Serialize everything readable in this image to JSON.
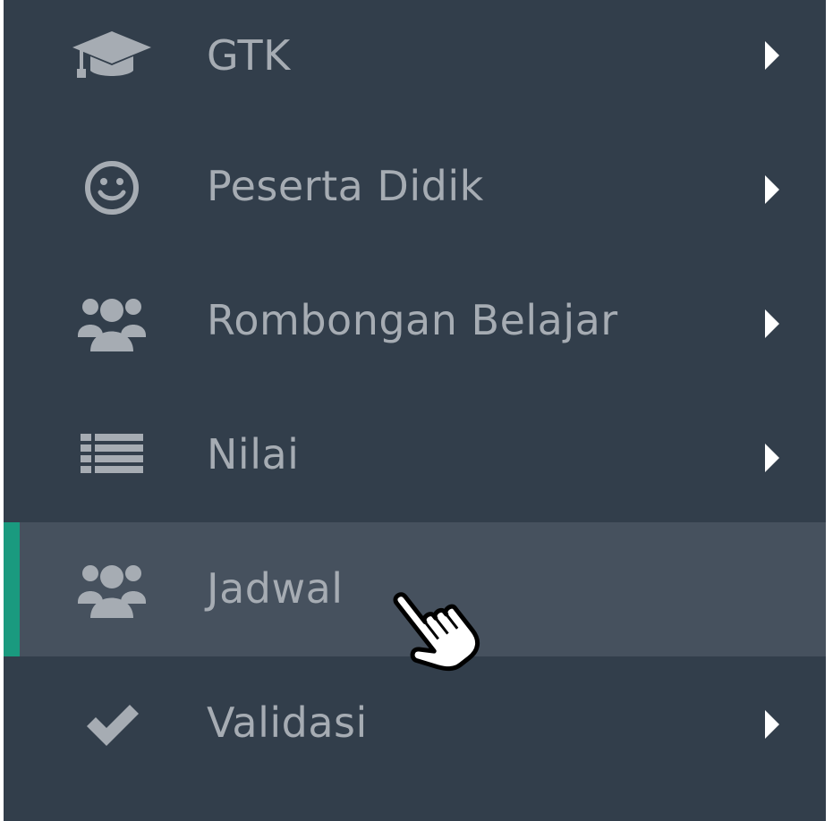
{
  "sidebar": {
    "items": [
      {
        "label": "GTK",
        "icon": "graduation-cap-icon",
        "has_submenu": true,
        "active": false
      },
      {
        "label": "Peserta Didik",
        "icon": "smile-icon",
        "has_submenu": true,
        "active": false
      },
      {
        "label": "Rombongan Belajar",
        "icon": "users-icon",
        "has_submenu": true,
        "active": false
      },
      {
        "label": "Nilai",
        "icon": "list-icon",
        "has_submenu": true,
        "active": false
      },
      {
        "label": "Jadwal",
        "icon": "users-icon",
        "has_submenu": false,
        "active": true
      },
      {
        "label": "Validasi",
        "icon": "check-icon",
        "has_submenu": true,
        "active": false
      }
    ]
  },
  "colors": {
    "sidebar_bg": "#323e4b",
    "active_bg": "#46515e",
    "accent": "#1a9a7f",
    "text": "#a6acb3",
    "chevron": "#ffffff"
  }
}
